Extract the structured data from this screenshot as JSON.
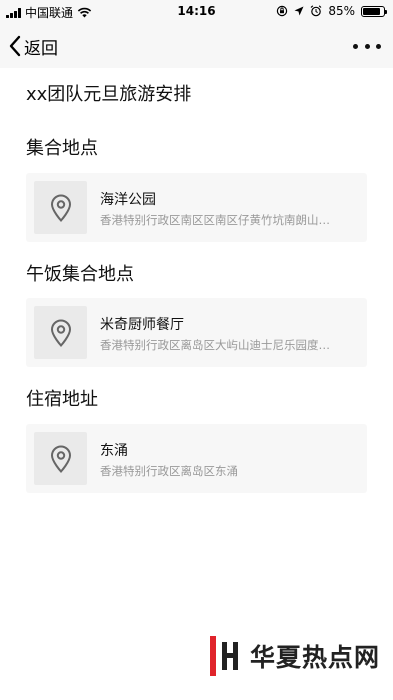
{
  "status_bar": {
    "carrier": "中国联通",
    "time": "14:16",
    "battery_percent": "85%",
    "battery_level": 0.85,
    "icons": [
      "signal-icon",
      "wifi-icon",
      "orientation-lock-icon",
      "location-arrow-icon",
      "alarm-icon",
      "battery-icon"
    ]
  },
  "nav": {
    "back_label": "返回",
    "more_icon": "more-dots-icon"
  },
  "page": {
    "title": "xx团队元旦旅游安排"
  },
  "sections": [
    {
      "title": "集合地点",
      "location": {
        "name": "海洋公园",
        "address": "香港特别行政区南区区南区仔黄竹坑南朗山…",
        "icon": "map-pin-icon"
      }
    },
    {
      "title": "午饭集合地点",
      "location": {
        "name": "米奇厨师餐厅",
        "address": "香港特别行政区离岛区大屿山迪士尼乐园度…",
        "icon": "map-pin-icon"
      }
    },
    {
      "title": "住宿地址",
      "location": {
        "name": "东涌",
        "address": "香港特别行政区离岛区东涌",
        "icon": "map-pin-icon"
      }
    }
  ],
  "watermark": {
    "text": "华夏热点网",
    "logo_color": "#e0242b"
  },
  "colors": {
    "bar_bg": "#f7f7f7",
    "card_bg": "#f7f7f7",
    "thumb_bg": "#eaeaea",
    "secondary_text": "#999999"
  }
}
